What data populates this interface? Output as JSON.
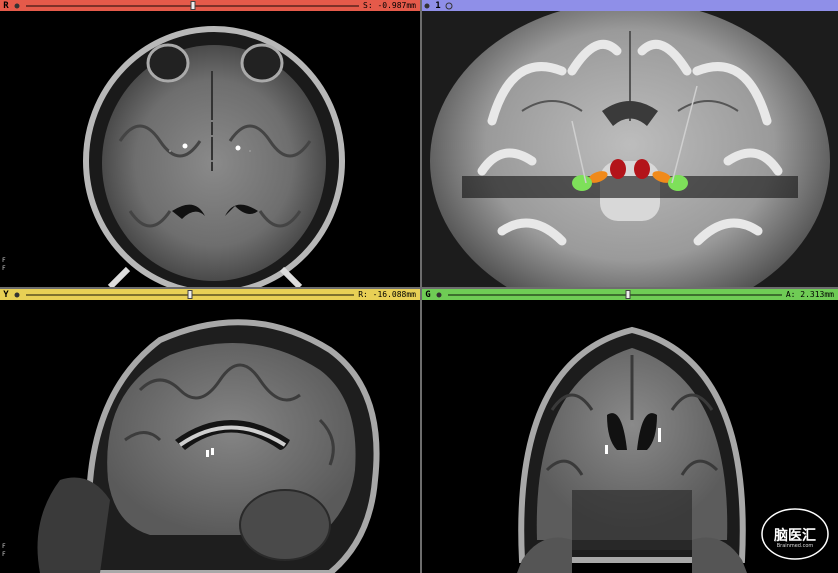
{
  "views": [
    {
      "id": "red",
      "letter": "R",
      "bar_color": "#e55a4a",
      "readout": "S: -0.987mm",
      "slider_position": 0.5,
      "side_labels": [
        "F",
        "F"
      ]
    },
    {
      "id": "three-d",
      "letter": "1",
      "bar_color": "#8f8fe8",
      "readout": "",
      "slider_position": null,
      "side_labels": []
    },
    {
      "id": "yellow",
      "letter": "Y",
      "bar_color": "#e8d055",
      "readout": "R: -16.088mm",
      "slider_position": 0.5,
      "side_labels": [
        "F",
        "F"
      ]
    },
    {
      "id": "green",
      "letter": "G",
      "bar_color": "#6fcc55",
      "readout": "A: 2.313mm",
      "slider_position": 0.54,
      "side_labels": []
    }
  ],
  "watermark": {
    "text": "脑医汇",
    "subtext": "Brainmed.com"
  },
  "icons": {
    "pin": "pin-icon",
    "link": "link-icon"
  }
}
